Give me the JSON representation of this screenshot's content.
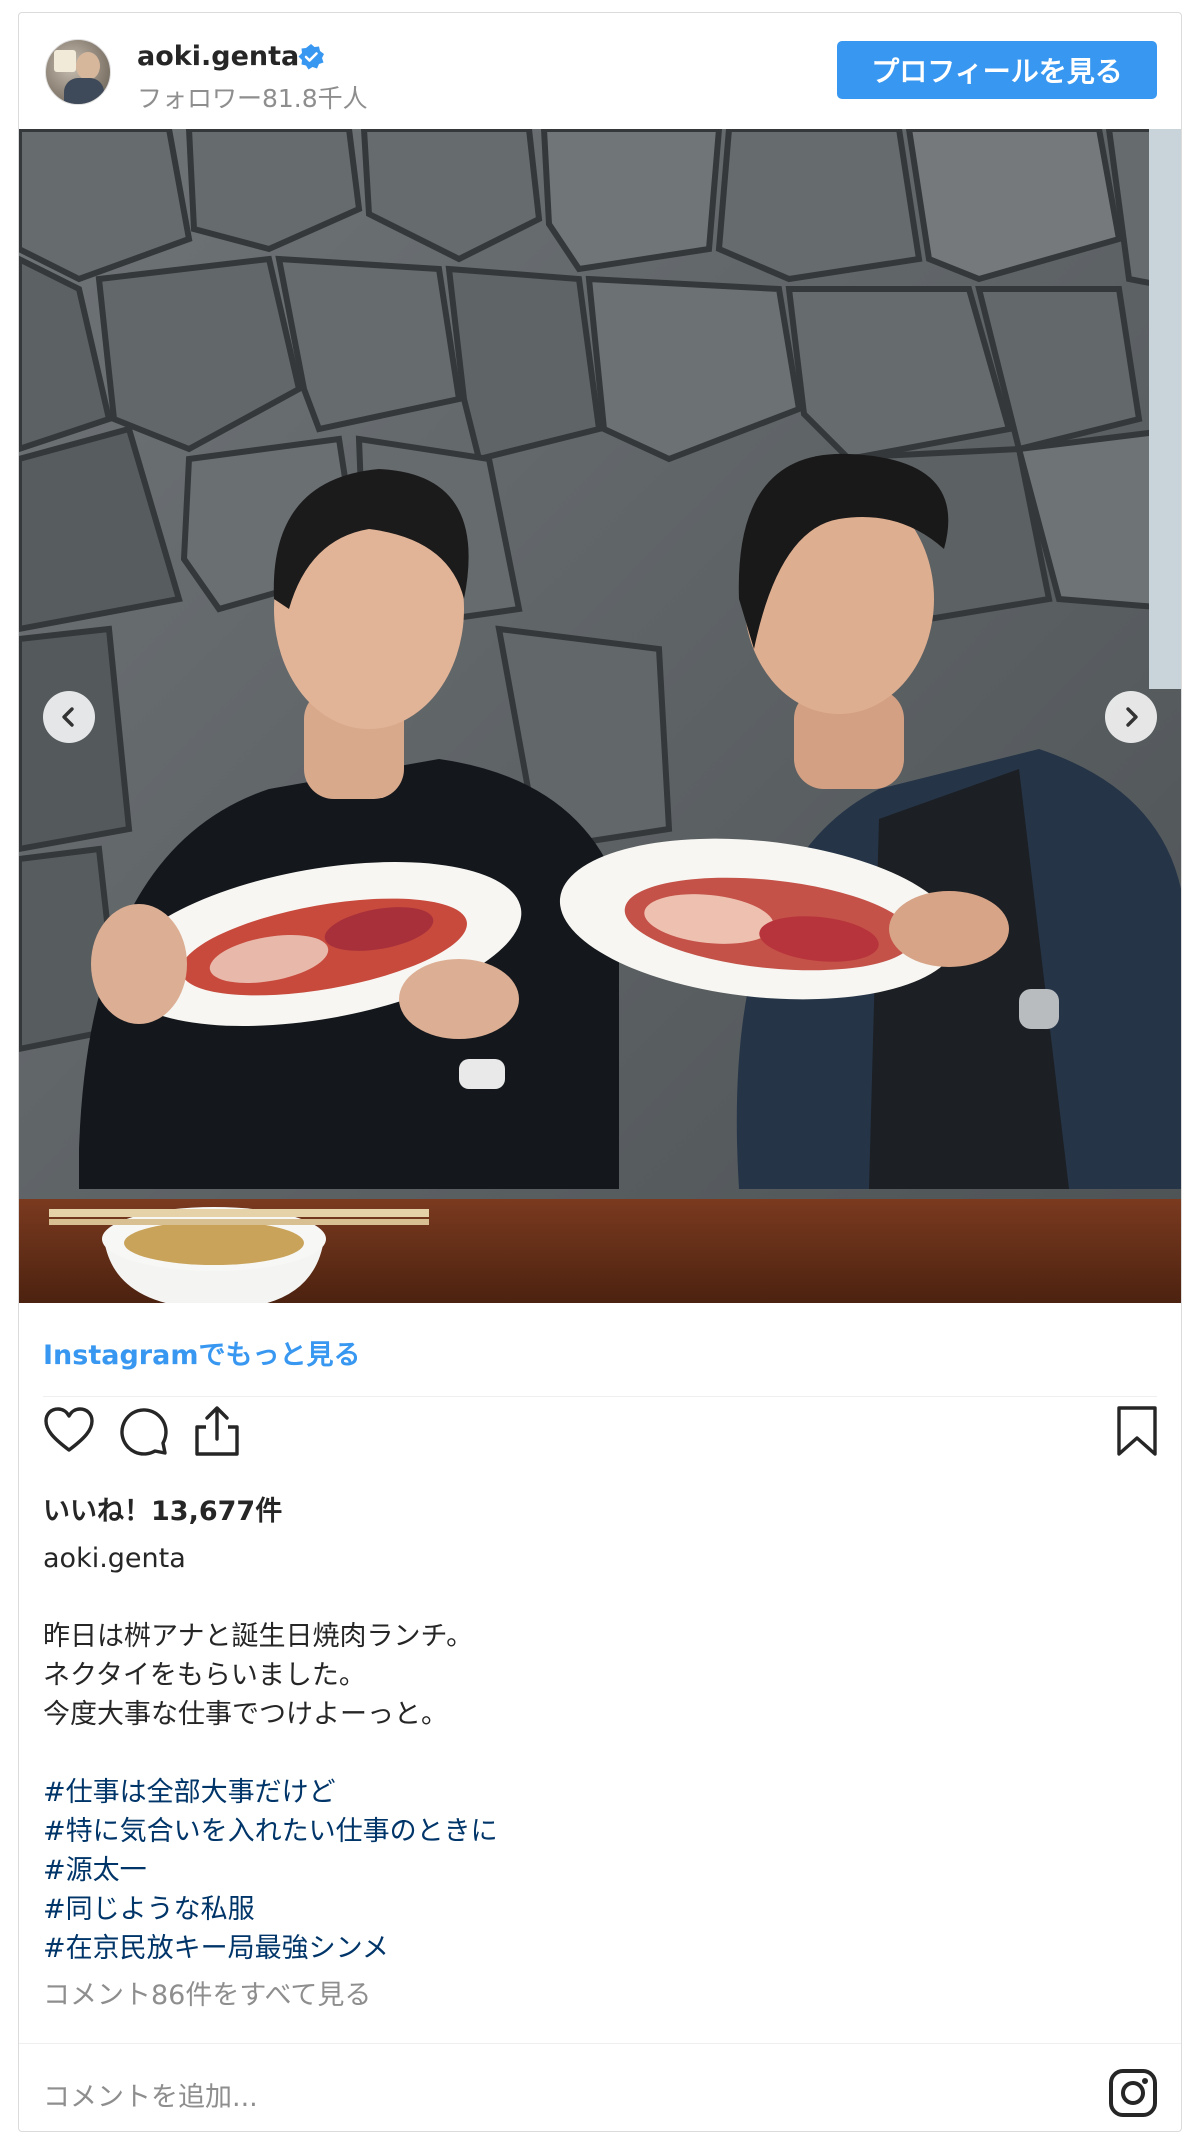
{
  "header": {
    "username": "aoki.genta",
    "followers": "フォロワー81.8千人",
    "profile_button": "プロフィールを見る",
    "avatar_icon": "avatar-icon",
    "verified_icon": "verified-badge-icon"
  },
  "photo": {
    "prev_icon": "chevron-left-icon",
    "next_icon": "chevron-right-icon"
  },
  "more_link": "Instagramでもっと見る",
  "actions": {
    "like_icon": "heart-icon",
    "comment_icon": "comment-icon",
    "share_icon": "share-icon",
    "save_icon": "bookmark-icon"
  },
  "likes": "いいね！13,677件",
  "author": "aoki.genta",
  "caption": {
    "line1": "昨日は桝アナと誕生日焼肉ランチ。",
    "line2": "ネクタイをもらいました。",
    "line3": "今度大事な仕事でつけよーっと。"
  },
  "hashtags": [
    "#仕事は全部大事だけど",
    "#特に気合いを入れたい仕事のときに",
    "#源太一",
    "#同じような私服",
    "#在京民放キー局最強シンメ"
  ],
  "all_comments": "コメント86件をすべて見る",
  "comment_placeholder": "コメントを追加...",
  "colors": {
    "accent": "#3897f0",
    "hashtag": "#003569",
    "muted": "#8e8e8e"
  }
}
